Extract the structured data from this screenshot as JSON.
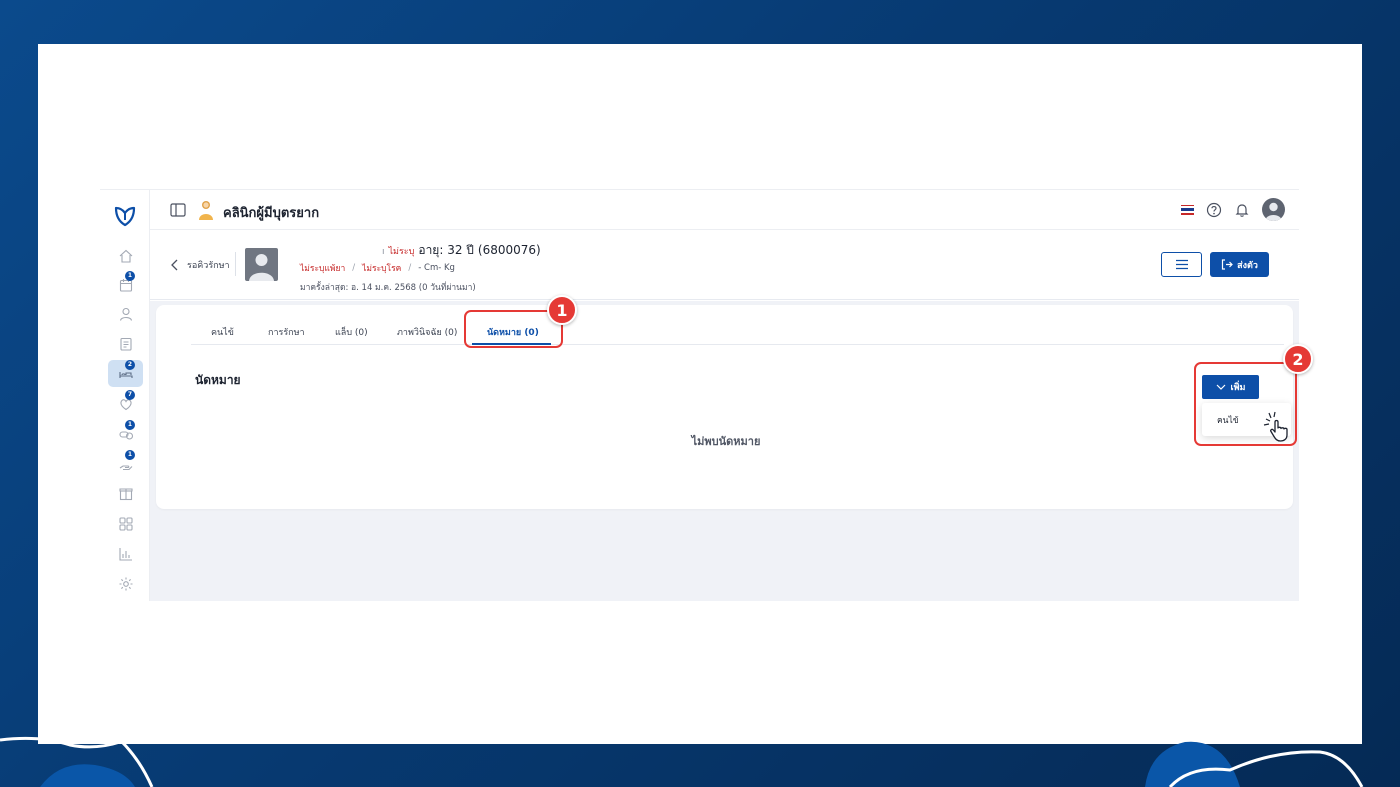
{
  "topbar": {
    "clinic_name": "คลินิกผู้มีบุตรยาก"
  },
  "sidebar": {
    "items": [
      {
        "name": "home",
        "badge": ""
      },
      {
        "name": "calendar",
        "badge": "1"
      },
      {
        "name": "user",
        "badge": ""
      },
      {
        "name": "record",
        "badge": ""
      },
      {
        "name": "treatment",
        "badge": "2",
        "active": true
      },
      {
        "name": "heart",
        "badge": "7"
      },
      {
        "name": "pills",
        "badge": "1"
      },
      {
        "name": "hand-care",
        "badge": "1"
      },
      {
        "name": "box",
        "badge": ""
      },
      {
        "name": "apps",
        "badge": ""
      },
      {
        "name": "report",
        "badge": ""
      },
      {
        "name": "settings",
        "badge": ""
      }
    ]
  },
  "patient": {
    "back_label": "รอคิวรักษา",
    "gender": "ไม่ระบุ",
    "age_text": "อายุ: 32 ปี",
    "hn": "(6800076)",
    "allergy": "ไม่ระบุแพ้ยา",
    "disease": "ไม่ระบุโรค",
    "body": "- Cm- Kg",
    "last_visit": "มาครั้งล่าสุด: อ. 14 ม.ค. 2568 (0 วันที่ผ่านมา)",
    "send_label": "ส่งตัว"
  },
  "tabs": [
    {
      "label": "คนไข้"
    },
    {
      "label": "การรักษา"
    },
    {
      "label": "แล็บ (0)"
    },
    {
      "label": "ภาพวินิจฉัย (0)"
    },
    {
      "label": "นัดหมาย (0)",
      "active": true
    }
  ],
  "section": {
    "title": "นัดหมาย",
    "empty_message": "ไม่พบนัดหมาย",
    "add_label": "เพิ่ม",
    "dropdown_items": [
      "คนไข้"
    ]
  },
  "annotations": {
    "step1": "1",
    "step2": "2",
    "color": "#e53935"
  },
  "colors": {
    "primary": "#0d4fa8",
    "danger": "#c62828",
    "background": "#0b4a8c"
  }
}
